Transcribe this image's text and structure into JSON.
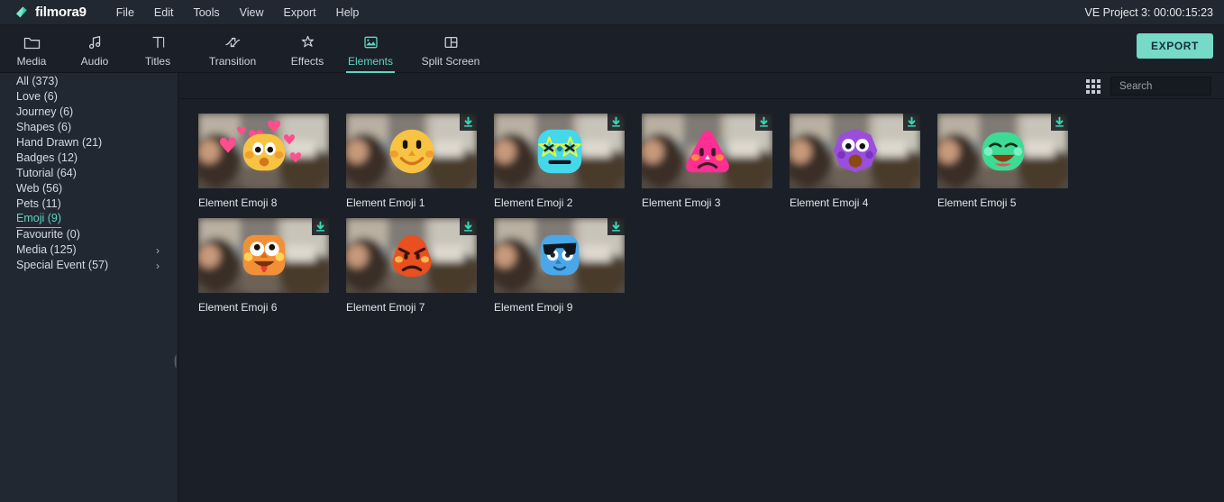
{
  "app": {
    "brand": "filmora9",
    "logo_icon": "filmora-diamond-icon",
    "accent_color": "#5fd5c4",
    "project_title": "VE Project 3:  00:00:15:23"
  },
  "menubar": {
    "items": [
      {
        "label": "File"
      },
      {
        "label": "Edit"
      },
      {
        "label": "Tools"
      },
      {
        "label": "View"
      },
      {
        "label": "Export"
      },
      {
        "label": "Help"
      }
    ]
  },
  "toolbar": {
    "tabs": [
      {
        "label": "Media",
        "icon": "folder-icon",
        "active": false
      },
      {
        "label": "Audio",
        "icon": "music-note-icon",
        "active": false
      },
      {
        "label": "Titles",
        "icon": "text-t-icon",
        "active": false
      },
      {
        "label": "Transition",
        "icon": "transition-icon",
        "active": false
      },
      {
        "label": "Effects",
        "icon": "sparkle-icon",
        "active": false
      },
      {
        "label": "Elements",
        "icon": "image-icon",
        "active": true
      },
      {
        "label": "Split Screen",
        "icon": "split-screen-icon",
        "active": false
      }
    ],
    "export_label": "EXPORT"
  },
  "sidebar": {
    "items": [
      {
        "label": "All (373)",
        "selected": false,
        "chevron": false
      },
      {
        "label": "Love (6)",
        "selected": false,
        "chevron": false
      },
      {
        "label": "Journey (6)",
        "selected": false,
        "chevron": false
      },
      {
        "label": "Shapes (6)",
        "selected": false,
        "chevron": false
      },
      {
        "label": "Hand Drawn (21)",
        "selected": false,
        "chevron": false
      },
      {
        "label": "Badges (12)",
        "selected": false,
        "chevron": false
      },
      {
        "label": "Tutorial (64)",
        "selected": false,
        "chevron": false
      },
      {
        "label": "Web (56)",
        "selected": false,
        "chevron": false
      },
      {
        "label": "Pets (11)",
        "selected": false,
        "chevron": false
      },
      {
        "label": "Emoji (9)",
        "selected": true,
        "chevron": false
      },
      {
        "label": "Favourite (0)",
        "selected": false,
        "chevron": false
      },
      {
        "label": "Media (125)",
        "selected": false,
        "chevron": true
      },
      {
        "label": "Special Event (57)",
        "selected": false,
        "chevron": true
      }
    ],
    "chevron_glyph": "›",
    "collapse_handle": "panel-collapse-handle"
  },
  "content_header": {
    "grid_view_icon": "grid-view-icon",
    "search": {
      "placeholder": "Search",
      "value": "",
      "icon": "search-icon"
    }
  },
  "library": {
    "download_badge_icon": "download-icon",
    "items": [
      {
        "label": "Element Emoji 8",
        "emoji": "blush-hearts",
        "color": "#f7c342",
        "downloaded": false
      },
      {
        "label": "Element Emoji 1",
        "emoji": "smile",
        "color": "#f7c342",
        "downloaded": true
      },
      {
        "label": "Element Emoji 2",
        "emoji": "star-eyes",
        "color": "#45d8e8",
        "downloaded": true
      },
      {
        "label": "Element Emoji 3",
        "emoji": "sad-tear",
        "color": "#ff2e93",
        "downloaded": true
      },
      {
        "label": "Element Emoji 4",
        "emoji": "shocked",
        "color": "#9b4ddb",
        "downloaded": true
      },
      {
        "label": "Element Emoji 5",
        "emoji": "laughing",
        "color": "#3ddb93",
        "downloaded": true
      },
      {
        "label": "Element Emoji 6",
        "emoji": "tongue-out",
        "color": "#f29038",
        "downloaded": true
      },
      {
        "label": "Element Emoji 7",
        "emoji": "angry",
        "color": "#e8501f",
        "downloaded": true
      },
      {
        "label": "Element Emoji 9",
        "emoji": "cool-sunglasses",
        "color": "#4aa8e8",
        "downloaded": true
      }
    ]
  }
}
